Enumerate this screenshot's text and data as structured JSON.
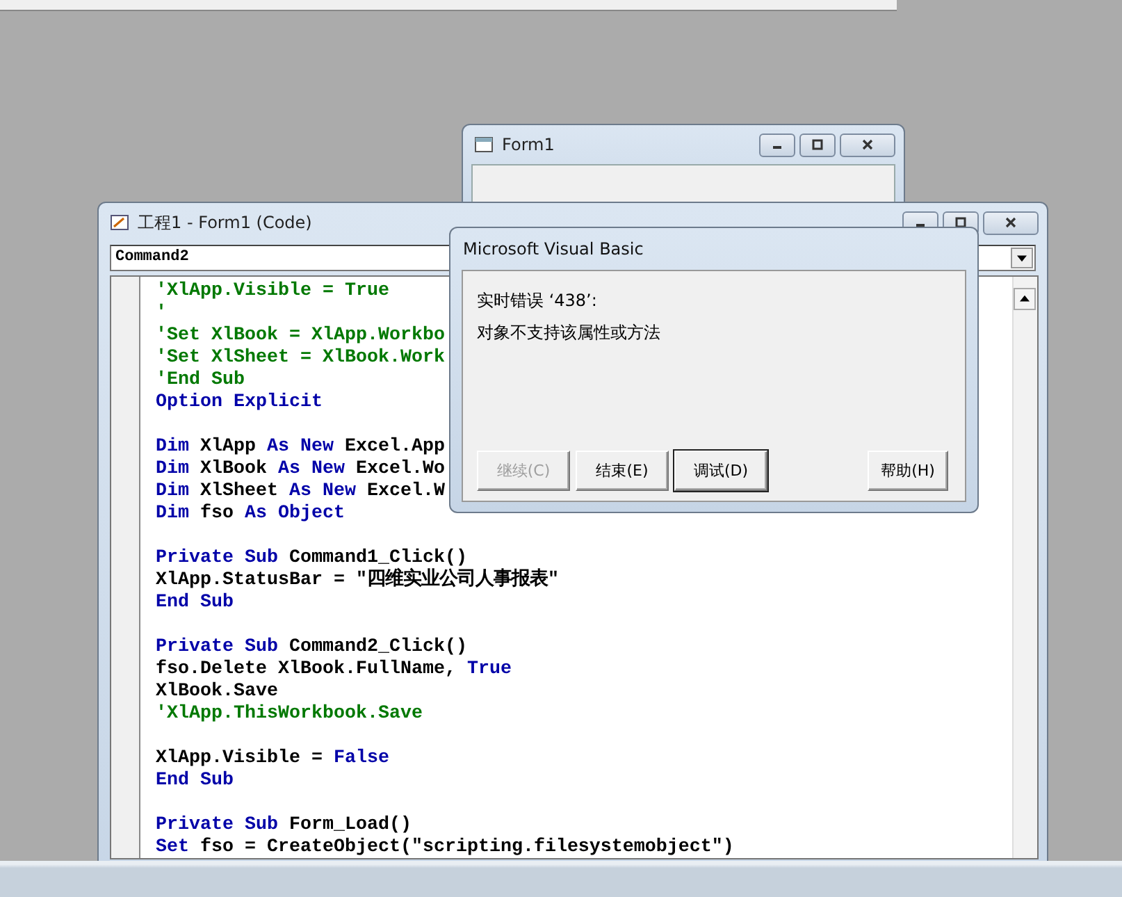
{
  "form_window": {
    "title": "Form1"
  },
  "code_window": {
    "title": "工程1 - Form1 (Code)",
    "object_combo": "Command2",
    "lines": [
      {
        "kind": "code",
        "segments": [
          {
            "text": "'XlApp.Visible = True",
            "kind": "comment"
          }
        ]
      },
      {
        "kind": "code",
        "segments": [
          {
            "text": "'",
            "kind": "comment"
          }
        ]
      },
      {
        "kind": "code",
        "segments": [
          {
            "text": "'Set XlBook = XlApp.Workbo",
            "kind": "comment"
          }
        ]
      },
      {
        "kind": "code",
        "segments": [
          {
            "text": "'Set XlSheet = XlBook.Work",
            "kind": "comment"
          }
        ]
      },
      {
        "kind": "code",
        "segments": [
          {
            "text": "'End Sub",
            "kind": "comment"
          }
        ]
      },
      {
        "kind": "code",
        "segments": [
          {
            "text": "Option Explicit",
            "kind": "keyword"
          }
        ]
      },
      {
        "kind": "blank"
      },
      {
        "kind": "code",
        "segments": [
          {
            "text": "Dim",
            "kind": "keyword"
          },
          {
            "text": " XlApp ",
            "kind": "plain"
          },
          {
            "text": "As New",
            "kind": "keyword"
          },
          {
            "text": " Excel.App",
            "kind": "plain"
          }
        ]
      },
      {
        "kind": "code",
        "segments": [
          {
            "text": "Dim",
            "kind": "keyword"
          },
          {
            "text": " XlBook ",
            "kind": "plain"
          },
          {
            "text": "As New",
            "kind": "keyword"
          },
          {
            "text": " Excel.Wo",
            "kind": "plain"
          }
        ]
      },
      {
        "kind": "code",
        "segments": [
          {
            "text": "Dim",
            "kind": "keyword"
          },
          {
            "text": " XlSheet ",
            "kind": "plain"
          },
          {
            "text": "As New",
            "kind": "keyword"
          },
          {
            "text": " Excel.W",
            "kind": "plain"
          }
        ]
      },
      {
        "kind": "code",
        "segments": [
          {
            "text": "Dim",
            "kind": "keyword"
          },
          {
            "text": " fso ",
            "kind": "plain"
          },
          {
            "text": "As Object",
            "kind": "keyword"
          }
        ]
      },
      {
        "kind": "blank"
      },
      {
        "kind": "code",
        "segments": [
          {
            "text": "Private Sub",
            "kind": "keyword"
          },
          {
            "text": " Command1_Click()",
            "kind": "plain"
          }
        ]
      },
      {
        "kind": "code",
        "segments": [
          {
            "text": "XlApp.StatusBar = \"四维实业公司人事报表\"",
            "kind": "plain"
          }
        ]
      },
      {
        "kind": "code",
        "segments": [
          {
            "text": "End Sub",
            "kind": "keyword"
          }
        ]
      },
      {
        "kind": "blank"
      },
      {
        "kind": "code",
        "segments": [
          {
            "text": "Private Sub",
            "kind": "keyword"
          },
          {
            "text": " Command2_Click()",
            "kind": "plain"
          }
        ]
      },
      {
        "kind": "code",
        "segments": [
          {
            "text": "fso.Delete XlBook.FullName, ",
            "kind": "plain"
          },
          {
            "text": "True",
            "kind": "keyword"
          }
        ]
      },
      {
        "kind": "code",
        "segments": [
          {
            "text": "XlBook.Save",
            "kind": "plain"
          }
        ]
      },
      {
        "kind": "code",
        "segments": [
          {
            "text": "'XlApp.ThisWorkbook.Save",
            "kind": "comment"
          }
        ]
      },
      {
        "kind": "blank"
      },
      {
        "kind": "code",
        "segments": [
          {
            "text": "XlApp.Visible = ",
            "kind": "plain"
          },
          {
            "text": "False",
            "kind": "keyword"
          }
        ]
      },
      {
        "kind": "code",
        "segments": [
          {
            "text": "End Sub",
            "kind": "keyword"
          }
        ]
      },
      {
        "kind": "blank"
      },
      {
        "kind": "code",
        "segments": [
          {
            "text": "Private Sub",
            "kind": "keyword"
          },
          {
            "text": " Form_Load()",
            "kind": "plain"
          }
        ]
      },
      {
        "kind": "code",
        "segments": [
          {
            "text": "Set",
            "kind": "keyword"
          },
          {
            "text": " fso = CreateObject(\"scripting.filesystemobject\")",
            "kind": "plain"
          }
        ]
      }
    ]
  },
  "dialog": {
    "title": "Microsoft Visual Basic",
    "message_lines": [
      "实时错误 ‘438’:",
      "对象不支持该属性或方法"
    ],
    "buttons": [
      {
        "label": "继续(C)",
        "disabled": true,
        "default": false
      },
      {
        "label": "结束(E)",
        "disabled": false,
        "default": false
      },
      {
        "label": "调试(D)",
        "disabled": false,
        "default": true
      },
      {
        "label": "帮助(H)",
        "disabled": false,
        "default": false
      }
    ]
  }
}
